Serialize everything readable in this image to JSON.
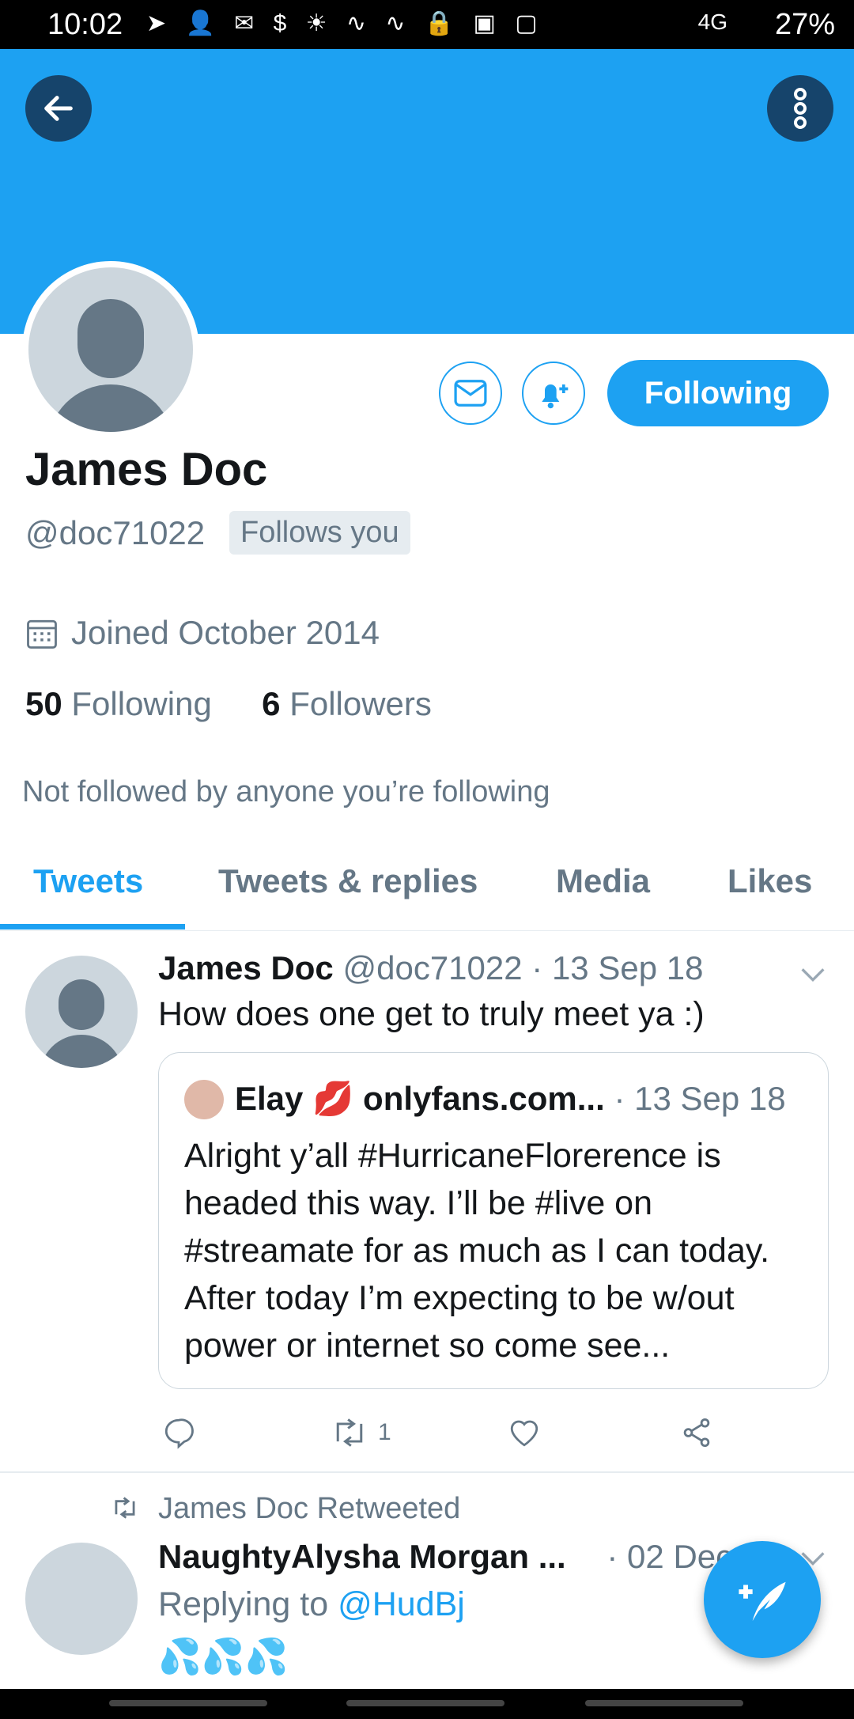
{
  "status_bar": {
    "time": "10:02",
    "network": "4G",
    "battery": "27%"
  },
  "profile": {
    "name": "James Doc",
    "handle": "@doc71022",
    "follows_you_badge": "Follows you",
    "joined": "Joined October 2014",
    "following_count": "50",
    "following_label": "Following",
    "followers_count": "6",
    "followers_label": "Followers",
    "not_followed_note": "Not followed by anyone you’re following",
    "follow_button_label": "Following"
  },
  "tabs": [
    {
      "label": "Tweets",
      "active": true
    },
    {
      "label": "Tweets & replies",
      "active": false
    },
    {
      "label": "Media",
      "active": false
    },
    {
      "label": "Likes",
      "active": false
    }
  ],
  "tweets": [
    {
      "author": "James Doc",
      "handle": "@doc71022",
      "date": "· 13 Sep 18",
      "text": "How does one get to truly meet ya :)",
      "quote": {
        "author": "Elay 💋 onlyfans.com...",
        "date": "· 13 Sep 18",
        "text": "Alright y’all #HurricaneFlorerence is headed this way. I’ll be #live on #streamate for as much as I can today.  After today I’m expecting to be w/out power or internet so come see..."
      },
      "retweet_count": "1"
    },
    {
      "retweeted_by": "James Doc Retweeted",
      "author": "NaughtyAlysha Morgan ...",
      "date": "· 02 Dec",
      "replying_prefix": "Replying to",
      "replying_to": "@HudBj",
      "text": "💦💦💦"
    }
  ],
  "colors": {
    "accent": "#1da1f2",
    "banner": "#1da1f2",
    "muted": "#657786"
  }
}
